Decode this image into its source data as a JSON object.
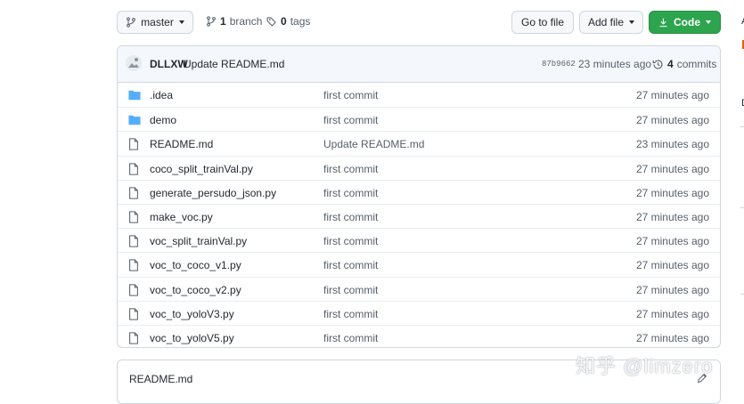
{
  "branch": {
    "label": "master",
    "count": "1",
    "count_label": "branch"
  },
  "tags": {
    "count": "0",
    "label": "tags"
  },
  "buttons": {
    "go_to_file": "Go to file",
    "add_file": "Add file",
    "code": "Code"
  },
  "colors": {
    "code_button": "#2da44e",
    "folder": "#54aeff",
    "commit_bar": "#f4f8fd"
  },
  "commit": {
    "author": "DLLXW",
    "message": "Update README.md",
    "sha": "87b9662",
    "time": "23 minutes ago",
    "count": "4",
    "count_label": "commits"
  },
  "files": [
    {
      "name": ".idea",
      "type": "folder",
      "message": "first commit",
      "age": "27 minutes ago"
    },
    {
      "name": "demo",
      "type": "folder",
      "message": "first commit",
      "age": "27 minutes ago"
    },
    {
      "name": "README.md",
      "type": "file",
      "message": "Update README.md",
      "age": "23 minutes ago"
    },
    {
      "name": "coco_split_trainVal.py",
      "type": "file",
      "message": "first commit",
      "age": "27 minutes ago"
    },
    {
      "name": "generate_persudo_json.py",
      "type": "file",
      "message": "first commit",
      "age": "27 minutes ago"
    },
    {
      "name": "make_voc.py",
      "type": "file",
      "message": "first commit",
      "age": "27 minutes ago"
    },
    {
      "name": "voc_split_trainVal.py",
      "type": "file",
      "message": "first commit",
      "age": "27 minutes ago"
    },
    {
      "name": "voc_to_coco_v1.py",
      "type": "file",
      "message": "first commit",
      "age": "27 minutes ago"
    },
    {
      "name": "voc_to_coco_v2.py",
      "type": "file",
      "message": "first commit",
      "age": "27 minutes ago"
    },
    {
      "name": "voc_to_yoloV3.py",
      "type": "file",
      "message": "first commit",
      "age": "27 minutes ago"
    },
    {
      "name": "voc_to_yoloV5.py",
      "type": "file",
      "message": "first commit",
      "age": "27 minutes ago"
    }
  ],
  "readme": {
    "title": "README.md"
  },
  "sidebar_fragments": [
    "A",
    "D"
  ],
  "watermark": "知乎 @limzero"
}
